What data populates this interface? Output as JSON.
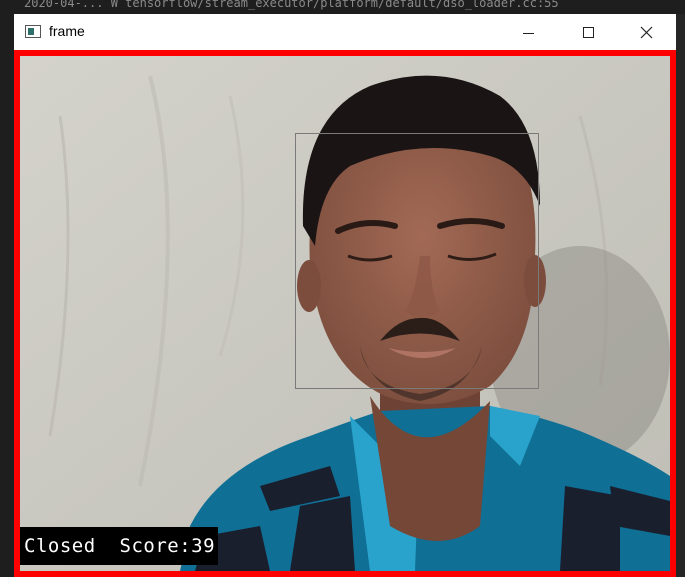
{
  "window": {
    "title": "frame",
    "icon": "opencv-window-icon"
  },
  "background_text": "2020-04-... W tensorflow/stream_executor/platform/default/dso_loader.cc:55",
  "controls": {
    "minimize_glyph": "—",
    "maximize_glyph": "☐",
    "close_glyph": "✕"
  },
  "frame": {
    "border_color": "#ff0000",
    "face_box_color": "#7a7a7a",
    "status": {
      "state": "Closed",
      "score_label": "Score:39"
    }
  }
}
